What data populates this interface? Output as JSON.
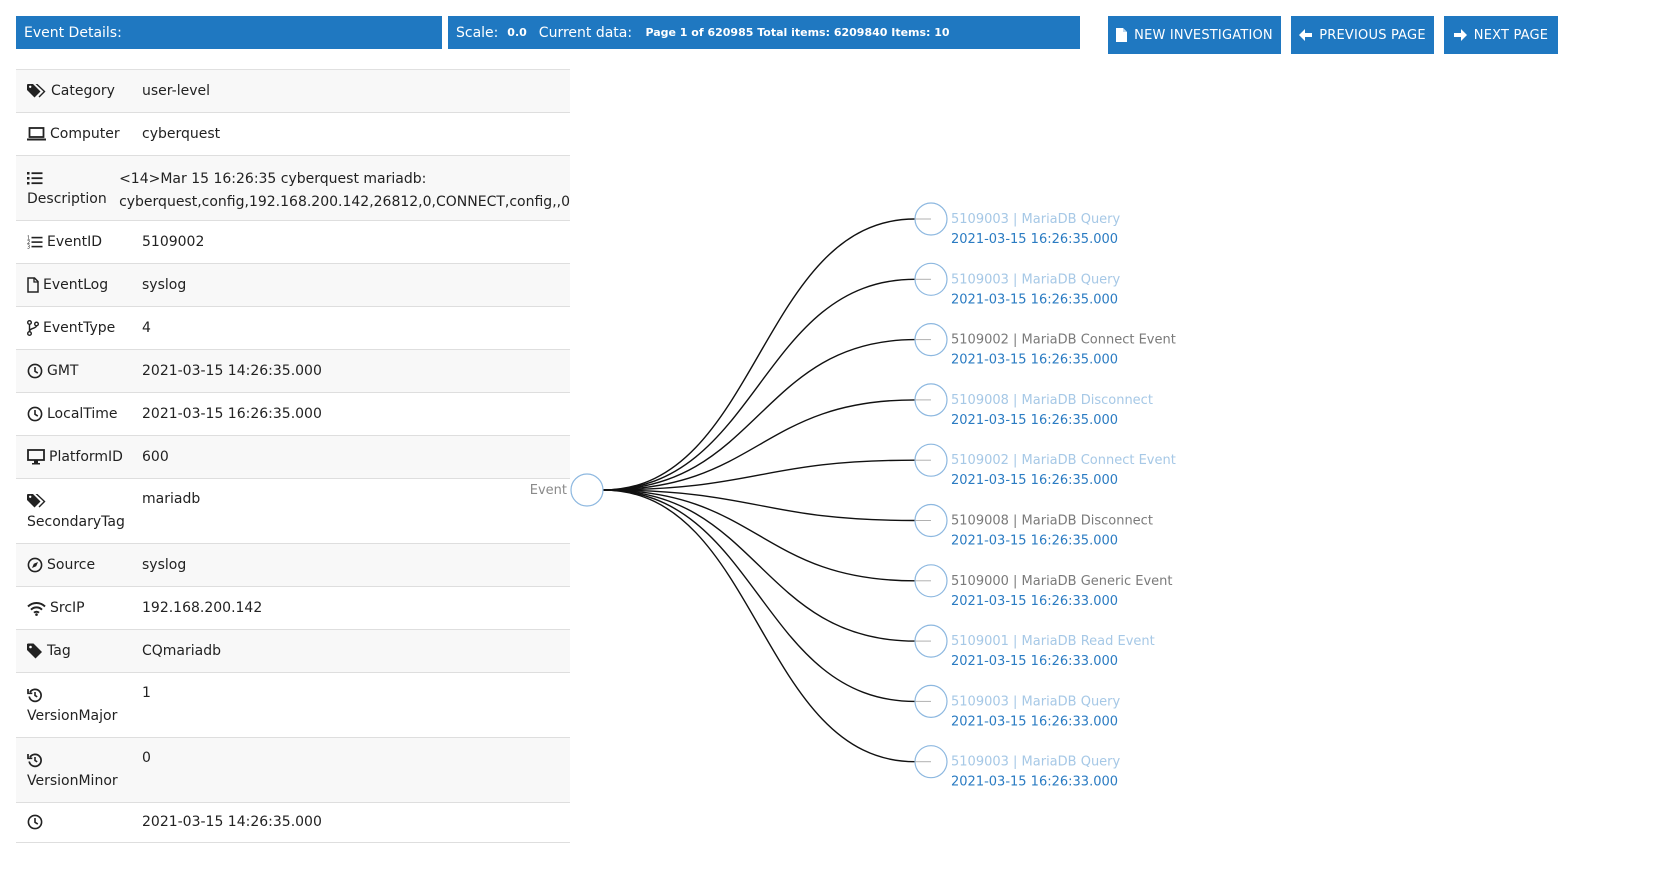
{
  "header": {
    "event_details": "Event Details:",
    "scale_label": "Scale:",
    "scale_value": "0.0",
    "current_data_label": "Current data:",
    "current_data_value": "Page 1 of 620985 Total items: 6209840 Items: 10"
  },
  "buttons": {
    "new_investigation": "NEW INVESTIGATION",
    "previous_page": "PREVIOUS PAGE",
    "next_page": "NEXT PAGE"
  },
  "details": [
    {
      "icon": "tags-icon",
      "key": "Category",
      "value": "user-level"
    },
    {
      "icon": "laptop-icon",
      "key": "Computer",
      "value": "cyberquest"
    },
    {
      "icon": "list-icon",
      "key": "Description",
      "value": "<14>Mar 15 16:26:35 cyberquest mariadb: cyberquest,config,192.168.200.142,26812,0,CONNECT,config,,0"
    },
    {
      "icon": "list-ol-icon",
      "key": "EventID",
      "value": "5109002"
    },
    {
      "icon": "file-icon",
      "key": "EventLog",
      "value": "syslog"
    },
    {
      "icon": "code-branch-icon",
      "key": "EventType",
      "value": "4"
    },
    {
      "icon": "clock-icon",
      "key": "GMT",
      "value": "2021-03-15 14:26:35.000"
    },
    {
      "icon": "clock-icon",
      "key": "LocalTime",
      "value": "2021-03-15 16:26:35.000"
    },
    {
      "icon": "desktop-icon",
      "key": "PlatformID",
      "value": "600"
    },
    {
      "icon": "tags-icon",
      "key": "SecondaryTag",
      "value": "mariadb"
    },
    {
      "icon": "compass-icon",
      "key": "Source",
      "value": "syslog"
    },
    {
      "icon": "wifi-icon",
      "key": "SrcIP",
      "value": "192.168.200.142"
    },
    {
      "icon": "tag-icon",
      "key": "Tag",
      "value": "CQmariadb"
    },
    {
      "icon": "history-icon",
      "key": "VersionMajor",
      "value": "1"
    },
    {
      "icon": "history-icon",
      "key": "VersionMinor",
      "value": "0"
    },
    {
      "icon": "clock-icon",
      "key": "",
      "value": "2021-03-15 14:26:35.000"
    }
  ],
  "graph": {
    "root_label": "Event",
    "colors": {
      "light_title": "#a6c8e6",
      "gray_title": "#7a7a7a",
      "time": "#2a7bc2",
      "circle": "#8db8e0"
    },
    "nodes": [
      {
        "title": "5109003 | MariaDB Query",
        "time": "2021-03-15 16:26:35.000",
        "style": "light"
      },
      {
        "title": "5109003 | MariaDB Query",
        "time": "2021-03-15 16:26:35.000",
        "style": "light"
      },
      {
        "title": "5109002 | MariaDB Connect Event",
        "time": "2021-03-15 16:26:35.000",
        "style": "gray"
      },
      {
        "title": "5109008 | MariaDB Disconnect",
        "time": "2021-03-15 16:26:35.000",
        "style": "light"
      },
      {
        "title": "5109002 | MariaDB Connect Event",
        "time": "2021-03-15 16:26:35.000",
        "style": "light"
      },
      {
        "title": "5109008 | MariaDB Disconnect",
        "time": "2021-03-15 16:26:35.000",
        "style": "gray"
      },
      {
        "title": "5109000 | MariaDB Generic Event",
        "time": "2021-03-15 16:26:33.000",
        "style": "gray"
      },
      {
        "title": "5109001 | MariaDB Read Event",
        "time": "2021-03-15 16:26:33.000",
        "style": "light"
      },
      {
        "title": "5109003 | MariaDB Query",
        "time": "2021-03-15 16:26:33.000",
        "style": "light"
      },
      {
        "title": "5109003 | MariaDB Query",
        "time": "2021-03-15 16:26:33.000",
        "style": "light"
      }
    ]
  }
}
